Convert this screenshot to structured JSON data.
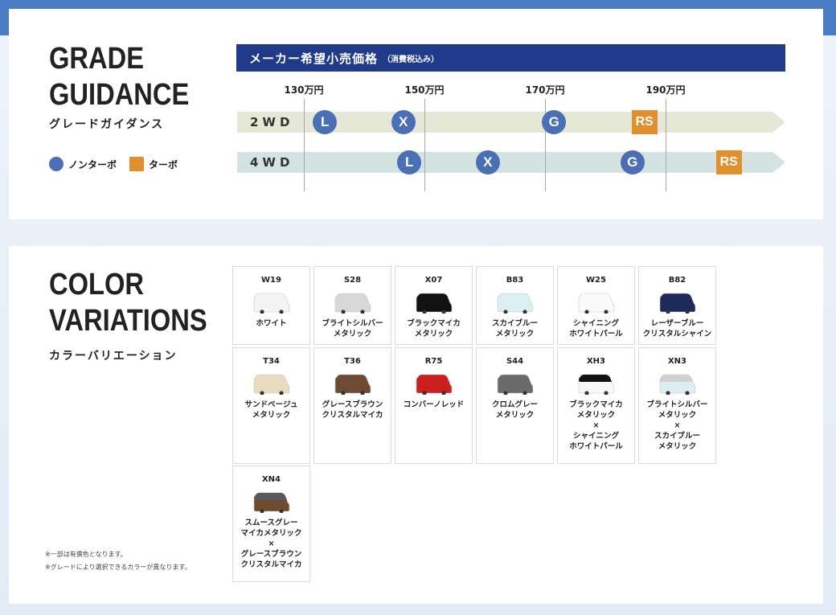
{
  "grade": {
    "title_line1": "GRADE",
    "title_line2": "GUIDANCE",
    "subtitle": "グレードガイダンス",
    "legend": [
      {
        "label": "ノンターボ",
        "color": "#4a6fb5"
      },
      {
        "label": "ターボ",
        "color": "#e0912e"
      }
    ],
    "price_header": "メーカー希望小売価格",
    "price_header_note": "（消費税込み）",
    "ticks": [
      "130万円",
      "150万円",
      "170万円",
      "190万円"
    ],
    "tick_values": [
      130,
      150,
      170,
      190
    ],
    "rows": [
      {
        "label": "2WD",
        "color": "#e6e8d7",
        "grades": [
          {
            "name": "L",
            "price": 133.5,
            "type": "nonturbo"
          },
          {
            "name": "X",
            "price": 146.5,
            "type": "nonturbo"
          },
          {
            "name": "G",
            "price": 171.5,
            "type": "nonturbo"
          },
          {
            "name": "RS",
            "price": 186.5,
            "type": "turbo"
          }
        ]
      },
      {
        "label": "4WD",
        "color": "#d5e2e2",
        "grades": [
          {
            "name": "L",
            "price": 147.5,
            "type": "nonturbo"
          },
          {
            "name": "X",
            "price": 160.5,
            "type": "nonturbo"
          },
          {
            "name": "G",
            "price": 184.5,
            "type": "nonturbo"
          },
          {
            "name": "RS",
            "price": 200.5,
            "type": "turbo"
          }
        ]
      }
    ]
  },
  "colors": {
    "title_line1": "COLOR",
    "title_line2": "VARIATIONS",
    "subtitle": "カラーバリエーション",
    "items": [
      {
        "code": "W19",
        "name": "ホワイト",
        "body": "#f4f4f4",
        "roof": "#f4f4f4"
      },
      {
        "code": "S28",
        "name": "ブライトシルバー\nメタリック",
        "body": "#d8d8d8",
        "roof": "#d8d8d8"
      },
      {
        "code": "X07",
        "name": "ブラックマイカ\nメタリック",
        "body": "#111111",
        "roof": "#111111"
      },
      {
        "code": "B83",
        "name": "スカイブルー\nメタリック",
        "body": "#dbeef3",
        "roof": "#dbeef3"
      },
      {
        "code": "W25",
        "name": "シャイニング\nホワイトパール",
        "body": "#fafafa",
        "roof": "#fafafa"
      },
      {
        "code": "B82",
        "name": "レーザーブルー\nクリスタルシャイン",
        "body": "#1f2a5c",
        "roof": "#1f2a5c"
      },
      {
        "code": "T34",
        "name": "サンドベージュ\nメタリック",
        "body": "#e8dcbf",
        "roof": "#e8dcbf"
      },
      {
        "code": "T36",
        "name": "グレースブラウン\nクリスタルマイカ",
        "body": "#6e4a30",
        "roof": "#6e4a30"
      },
      {
        "code": "R75",
        "name": "コンバーノレッド",
        "body": "#cc1f1f",
        "roof": "#cc1f1f"
      },
      {
        "code": "S44",
        "name": "クロムグレー\nメタリック",
        "body": "#6a6a6a",
        "roof": "#6a6a6a"
      },
      {
        "code": "XH3",
        "name": "ブラックマイカ\nメタリック\n×\nシャイニング\nホワイトパール",
        "body": "#f8f8f8",
        "roof": "#111111"
      },
      {
        "code": "XN3",
        "name": "ブライトシルバー\nメタリック\n×\nスカイブルー\nメタリック",
        "body": "#dbeef3",
        "roof": "#d0d0d0"
      },
      {
        "code": "XN4",
        "name": "スムースグレー\nマイカメタリック\n×\nグレースブラウン\nクリスタルマイカ",
        "body": "#6e4a30",
        "roof": "#5a5a5a"
      }
    ],
    "notes": [
      "※一部は有償色となります。",
      "※グレードにより選択できるカラーが異なります。"
    ]
  }
}
